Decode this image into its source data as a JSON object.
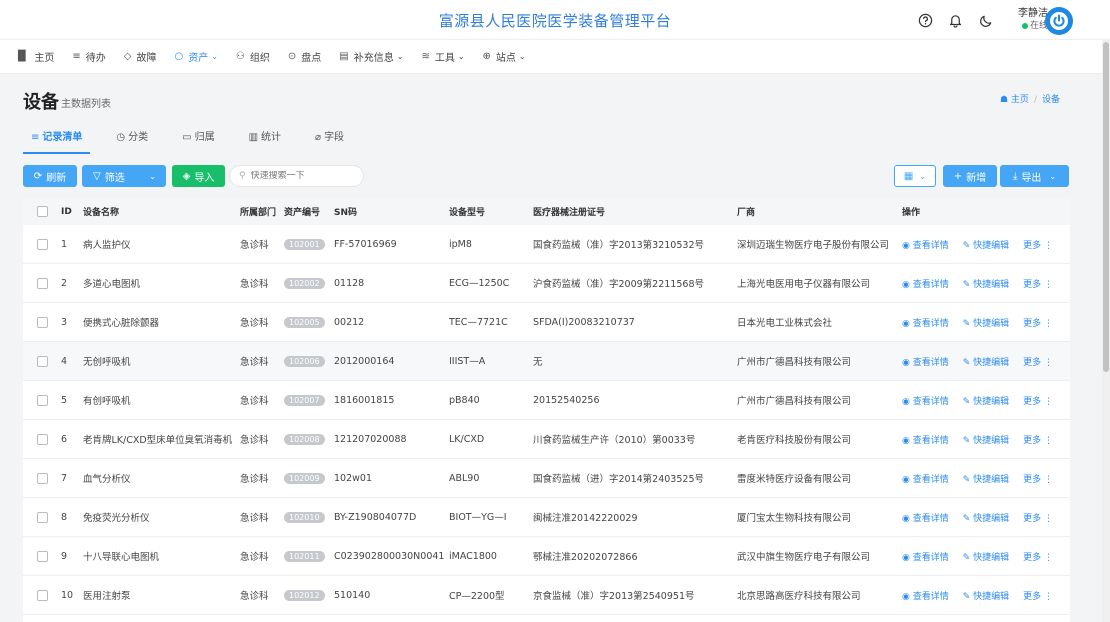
{
  "app": {
    "title": "富源县人民医院医学装备管理平台"
  },
  "user": {
    "name": "李静洁",
    "status": "在线"
  },
  "nav": [
    {
      "label": "主页",
      "icon": "bar-chart-icon",
      "glyph": "▐▌",
      "has_caret": false,
      "active": false
    },
    {
      "label": "待办",
      "icon": "list-icon",
      "glyph": "≡",
      "has_caret": false,
      "active": false
    },
    {
      "label": "故障",
      "icon": "shield-icon",
      "glyph": "◇",
      "has_caret": false,
      "active": false
    },
    {
      "label": "资产",
      "icon": "circle-icon",
      "glyph": "○",
      "has_caret": true,
      "active": true
    },
    {
      "label": "组织",
      "icon": "user-icon",
      "glyph": "⚇",
      "has_caret": false,
      "active": false
    },
    {
      "label": "盘点",
      "icon": "check-circle-icon",
      "glyph": "⊙",
      "has_caret": false,
      "active": false
    },
    {
      "label": "补充信息",
      "icon": "document-icon",
      "glyph": "▤",
      "has_caret": true,
      "active": false
    },
    {
      "label": "工具",
      "icon": "layers-icon",
      "glyph": "≋",
      "has_caret": true,
      "active": false
    },
    {
      "label": "站点",
      "icon": "globe-icon",
      "glyph": "⊕",
      "has_caret": true,
      "active": false
    }
  ],
  "page": {
    "title": "设备",
    "subtitle": "主数据列表"
  },
  "breadcrumb": {
    "home": "主页",
    "current": "设备"
  },
  "tabs": [
    {
      "label": "记录清单",
      "glyph": "≡",
      "active": true
    },
    {
      "label": "分类",
      "glyph": "◷",
      "active": false
    },
    {
      "label": "归属",
      "glyph": "▭",
      "active": false
    },
    {
      "label": "统计",
      "glyph": "▥",
      "active": false
    },
    {
      "label": "字段",
      "glyph": "⌀",
      "active": false
    }
  ],
  "toolbar": {
    "refresh": "刷新",
    "filter": "筛选",
    "import": "导入",
    "search_placeholder": "快速搜索一下",
    "add": "新增",
    "export": "导出"
  },
  "table": {
    "headers": {
      "id": "ID",
      "name": "设备名称",
      "dept": "所属部门",
      "asset": "资产编号",
      "sn": "SN码",
      "model": "设备型号",
      "reg": "医疗器械注册证号",
      "mfr": "厂商",
      "op": "操作"
    },
    "actions": {
      "view": "查看详情",
      "edit": "快捷编辑",
      "more": "更多"
    },
    "rows": [
      {
        "id": "1",
        "name": "病人监护仪",
        "dept": "急诊科",
        "asset": "102001",
        "sn": "FF-57016969",
        "model": "ipM8",
        "reg": "国食药监械（准）字2013第3210532号",
        "mfr": "深圳迈瑞生物医疗电子股份有限公司"
      },
      {
        "id": "2",
        "name": "多道心电图机",
        "dept": "急诊科",
        "asset": "102002",
        "sn": "01128",
        "model": "ECG—1250C",
        "reg": "沪食药监械（准）字2009第2211568号",
        "mfr": "上海光电医用电子仪器有限公司"
      },
      {
        "id": "3",
        "name": "便携式心脏除颤器",
        "dept": "急诊科",
        "asset": "102005",
        "sn": "00212",
        "model": "TEC—7721C",
        "reg": "SFDA(I)20083210737",
        "mfr": "日本光电工业株式会社"
      },
      {
        "id": "4",
        "name": "无创呼吸机",
        "dept": "急诊科",
        "asset": "102006",
        "sn": "2012000164",
        "model": "IIIST—A",
        "reg": "无",
        "mfr": "广州市广德昌科技有限公司"
      },
      {
        "id": "5",
        "name": "有创呼吸机",
        "dept": "急诊科",
        "asset": "102007",
        "sn": "1816001815",
        "model": "pB840",
        "reg": "20152540256",
        "mfr": "广州市广德昌科技有限公司"
      },
      {
        "id": "6",
        "name": "老肯牌LK/CXD型床单位臭氧消毒机",
        "dept": "急诊科",
        "asset": "102008",
        "sn": "121207020088",
        "model": "LK/CXD",
        "reg": "川食药监械生产许（2010）第0033号",
        "mfr": "老肯医疗科技股份有限公司"
      },
      {
        "id": "7",
        "name": "血气分析仪",
        "dept": "急诊科",
        "asset": "102009",
        "sn": "102w01",
        "model": "ABL90",
        "reg": "国食药监械（进）字2014第2403525号",
        "mfr": "雷度米特医疗设备有限公司"
      },
      {
        "id": "8",
        "name": "免疫荧光分析仪",
        "dept": "急诊科",
        "asset": "102010",
        "sn": "BY-Z190804077D",
        "model": "BIOT—YG—Ⅰ",
        "reg": "闽械注准20142220029",
        "mfr": "厦门宝太生物科技有限公司"
      },
      {
        "id": "9",
        "name": "十八导联心电图机",
        "dept": "急诊科",
        "asset": "102011",
        "sn": "C023902800030N0041",
        "model": "iMAC1800",
        "reg": "鄂械注准20202072866",
        "mfr": "武汉中旗生物医疗电子有限公司"
      },
      {
        "id": "10",
        "name": "医用注射泵",
        "dept": "急诊科",
        "asset": "102012",
        "sn": "510140",
        "model": "CP—2200型",
        "reg": "京食监械（准）字2013第2540951号",
        "mfr": "北京思路高医疗科技有限公司"
      }
    ]
  },
  "colors": {
    "primary": "#2d8cf0",
    "button_blue": "#45a6f5",
    "button_green": "#19be6b",
    "badge_gray": "#c5c8cc"
  }
}
